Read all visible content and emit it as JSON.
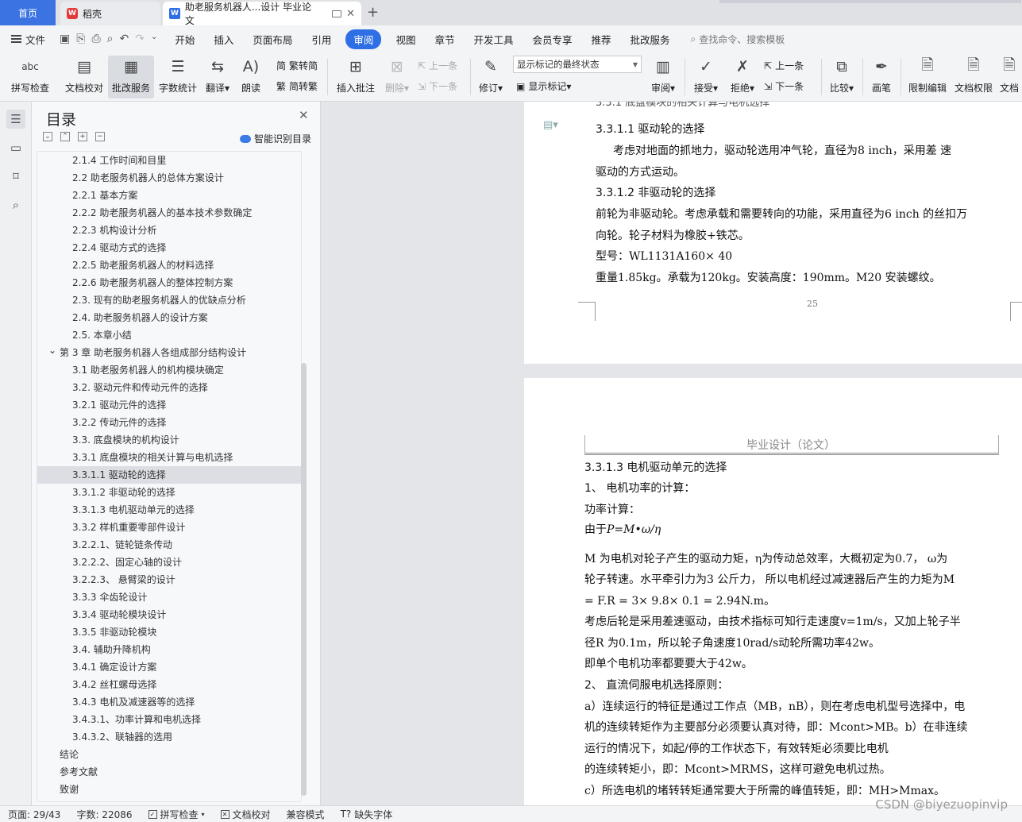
{
  "tabs": {
    "home": "首页",
    "wps": "稻壳",
    "doc": "助老服务机器人...设计 毕业论文"
  },
  "menu": {
    "file": "文件",
    "items": [
      "开始",
      "插入",
      "页面布局",
      "引用",
      "审阅",
      "视图",
      "章节",
      "开发工具",
      "会员专享",
      "推荐",
      "批改服务"
    ],
    "active_index": 4,
    "search": "查找命令、搜索模板"
  },
  "ribbon": {
    "spell": "拼写检查",
    "doccheck": "文档校对",
    "correction": "批改服务",
    "wordcount": "字数统计",
    "translate": "翻译",
    "read": "朗读",
    "trad": "繁转简",
    "simp": "简转繁",
    "insert_comment": "插入批注",
    "delete": "删除",
    "prev": "上一条",
    "next": "下一条",
    "track": "修订",
    "mark_state": "显示标记的最终状态",
    "show_marks": "显示标记",
    "review": "审阅",
    "accept": "接受",
    "reject": "拒绝",
    "prev2": "上一条",
    "next2": "下一条",
    "compare": "比较",
    "pen": "画笔",
    "restrict": "限制编辑",
    "permission": "文档权限",
    "more": "文档"
  },
  "outline": {
    "title": "目录",
    "smart": "智能识别目录",
    "items": [
      {
        "text": "2.1.4 工作时间和目里",
        "level": 2
      },
      {
        "text": "2.2 助老服务机器人的总体方案设计",
        "level": 2
      },
      {
        "text": "2.2.1 基本方案",
        "level": 2
      },
      {
        "text": "2.2.2 助老服务机器人的基本技术参数确定",
        "level": 2
      },
      {
        "text": "2.2.3 机构设计分析",
        "level": 2
      },
      {
        "text": "2.2.4  驱动方式的选择",
        "level": 2
      },
      {
        "text": "2.2.5  助老服务机器人的材料选择",
        "level": 2
      },
      {
        "text": "2.2.6  助老服务机器人的整体控制方案",
        "level": 2
      },
      {
        "text": "2.3.  现有的助老服务机器人的优缺点分析",
        "level": 2
      },
      {
        "text": "2.4.  助老服务机器人的设计方案",
        "level": 2
      },
      {
        "text": "2.5.  本章小结",
        "level": 2
      },
      {
        "text": "第 3 章  助老服务机器人各组成部分结构设计",
        "level": 1,
        "expanded": true
      },
      {
        "text": "3.1 助老服务机器人的机构模块确定",
        "level": 2
      },
      {
        "text": "3.2.  驱动元件和传动元件的选择",
        "level": 2
      },
      {
        "text": "3.2.1  驱动元件的选择",
        "level": 2
      },
      {
        "text": "3.2.2  传动元件的选择",
        "level": 2
      },
      {
        "text": "3.3.  底盘模块的机构设计",
        "level": 2
      },
      {
        "text": "3.3.1  底盘模块的相关计算与电机选择",
        "level": 2
      },
      {
        "text": "3.3.1.1  驱动轮的选择",
        "level": 2,
        "selected": true
      },
      {
        "text": "3.3.1.2  非驱动轮的选择",
        "level": 2
      },
      {
        "text": "3.3.1.3  电机驱动单元的选择",
        "level": 2
      },
      {
        "text": "3.3.2  样机重要零部件设计",
        "level": 2
      },
      {
        "text": "3.2.2.1、链轮链条传动",
        "level": 2
      },
      {
        "text": "3.2.2.2、固定心轴的设计",
        "level": 2
      },
      {
        "text": "3.2.2.3、  悬臂梁的设计",
        "level": 2
      },
      {
        "text": "3.3.3  伞齿轮设计",
        "level": 2
      },
      {
        "text": "3.3.4  驱动轮模块设计",
        "level": 2
      },
      {
        "text": "3.3.5  非驱动轮模块",
        "level": 2
      },
      {
        "text": "3.4.  辅助升降机构",
        "level": 2
      },
      {
        "text": "3.4.1  确定设计方案",
        "level": 2
      },
      {
        "text": "3.4.2  丝杠螺母选择",
        "level": 2
      },
      {
        "text": "3.4.3  电机及减速器等的选择",
        "level": 2
      },
      {
        "text": "3.4.3.1、功率计算和电机选择",
        "level": 2
      },
      {
        "text": "3.4.3.2、联轴器的选用",
        "level": 2
      },
      {
        "text": "结论",
        "level": 1
      },
      {
        "text": "参考文献",
        "level": 1
      },
      {
        "text": "致谢",
        "level": 1
      }
    ]
  },
  "page1": {
    "h1": "3.3.1.1  驱动轮的选择",
    "l1": "考虑对地面的抓地力，驱动轮选用冲气轮，直径为8 inch，采用差  速",
    "l2": "驱动的方式运动。",
    "h2": "3.3.1.2  非驱动轮的选择",
    "l3": "前轮为非驱动轮。考虑承载和需要转向的功能，采用直径为6 inch 的丝扣万",
    "l4": "向轮。轮子材料为橡胶+铁芯。",
    "l5": "型号：WL1131A160×  40",
    "l6": "重量1.85kg。承载为120kg。安装高度：190mm。M20 安装螺纹。",
    "page_num": "25"
  },
  "page2": {
    "header": "毕业设计（论文）",
    "h1": "3.3.1.3  电机驱动单元的选择",
    "s1": "1、  电机功率的计算：",
    "l1": "功率计算：",
    "l2a": "由于",
    "formula": "P=M•ω/η",
    "l3": "M 为电机对轮子产生的驱动力矩，η为传动总效率，大概初定为0.7，  ω为",
    "l4": "轮子转速。水平牵引力为3  公斤力，  所以电机经过减速器后产生的力矩为M",
    "l5": "= F.R = 3×  9.8×  0.1 = 2.94N.m。",
    "l6": "考虑后轮是采用差速驱动，由技术指标可知行走速度v=1m/s，又加上轮子半",
    "l7": "径R 为0.1m，所以轮子角速度10rad/s动轮所需功率42w。",
    "l8": "即单个电机功率都要要大于42w。",
    "s2": "2、  直流伺服电机选择原则：",
    "l9": "a）连续运行的特征是通过工作点（MB，nB），则在考虑电机型号选择中，电",
    "l10": "机的连续转矩作为主要部分必须要认真对待，即：Mcont>MB。b）在非连续",
    "l11": "运行的情况下，如起/停的工作状态下，有效转矩必须要比电机",
    "l12": "的连续转矩小，即：Mcont>MRMS，这样可避免电机过热。",
    "l13": "c）所选电机的堵转转矩通常要大于所需的峰值转矩，即：MH>Mmax。"
  },
  "status": {
    "page": "页面: 29/43",
    "words": "字数: 22086",
    "spell": "拼写检查",
    "doccheck": "文档校对",
    "compat": "兼容模式",
    "missing_font": "缺失字体"
  },
  "watermark": "CSDN @biyezuopinvip"
}
